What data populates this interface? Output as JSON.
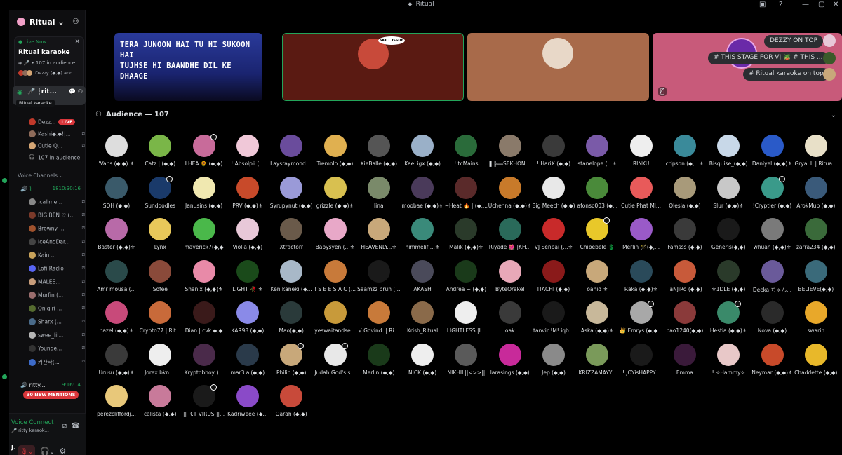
{
  "window": {
    "title": "Ritual"
  },
  "server": {
    "name": "Ritual",
    "chevron": "⌄",
    "invite_icon": "add-member-icon"
  },
  "live_card": {
    "live_now": "Live Now",
    "title": "Ritual karaoke",
    "meta": "• 107 in audience",
    "users": "Dezzy (◆,◆) and ..."
  },
  "active_channel": {
    "name": "┆rit...",
    "tooltip": "Ritual karaoke"
  },
  "stage_users": [
    {
      "name": "Dezz...",
      "live": "LIVE",
      "color": "#c0392b"
    },
    {
      "name": "Kashi◆.◆!|...",
      "color": "#8e6b5a"
    },
    {
      "name": "Cutie Q...",
      "color": "#d4a574"
    },
    {
      "name": "107 in audience",
      "color": ""
    }
  ],
  "voice_channels_label": "Voice Channels",
  "voice_channels": [
    {
      "name": "⌇",
      "time": "1810:30:16",
      "users": [
        {
          "name": ".callme...",
          "color": "#888"
        },
        {
          "name": "BIG BEN ♡ (...",
          "color": "#7b3a2a"
        },
        {
          "name": "Browny ...",
          "color": "#a0522d"
        },
        {
          "name": "IceAndDar...",
          "color": "#444"
        },
        {
          "name": "Kain ...",
          "color": "#c8a25a"
        },
        {
          "name": "Lofi Radio",
          "color": "#5865f2"
        },
        {
          "name": "MALEE...",
          "color": "#c79c7a"
        },
        {
          "name": "Murfin (...",
          "color": "#9a6d6d"
        },
        {
          "name": "Onigiri ...",
          "color": "#556b2f"
        },
        {
          "name": "Sharx (...",
          "color": "#4a6b8a"
        },
        {
          "name": "swee_lil...",
          "color": "#b5b5b5"
        },
        {
          "name": "Younge...",
          "color": "#333"
        },
        {
          "name": "커잔타(...",
          "color": "#3d6bc9"
        }
      ]
    },
    {
      "name": "ritty...",
      "time": "9:16:14"
    }
  ],
  "mentions": "30 NEW MENTIONS",
  "voice_panel": {
    "status": "Voice Connect",
    "sub": "ritty karaok..."
  },
  "user_panel": {
    "name": "J."
  },
  "stage": {
    "lyrics_line1": "TERA JUNOON HAI TU HI SUKOON HAI",
    "lyrics_line2": "TUJHSE HI BAANDHE DIL KE DHAAGE",
    "skill_badge": "SKILL ISSUE",
    "pills": [
      "DEZZY ON TOP",
      "# THIS STAGE FOR VJ 🪴 # THIS ...",
      "# Ritual karaoke on top"
    ]
  },
  "audience": {
    "label": "Audience — 107"
  },
  "audience_rows": [
    [
      {
        "n": "'Vans (◆,◆) ⚜",
        "c": "#ddd"
      },
      {
        "n": "Catz | (◆,◆)",
        "c": "#7ab648"
      },
      {
        "n": "LHEA 🌻 (◆,◆)",
        "c": "#c86b9a",
        "d": true
      },
      {
        "n": "! Absolpii (...",
        "c": "#f0c8d8"
      },
      {
        "n": "Laysraymond ...",
        "c": "#6a4c9c"
      },
      {
        "n": "Tremolo (◆,◆)",
        "c": "#e0b050"
      },
      {
        "n": "XieBalle (◆,◆)",
        "c": "#555"
      },
      {
        "n": "KaeLigx (◆,◆)",
        "c": "#9ab0c8"
      },
      {
        "n": "! tcMains",
        "c": "#2a6b3a"
      },
      {
        "n": "▌╠══SEKHON...",
        "c": "#8a7a6a"
      },
      {
        "n": "! HariX (◆,◆)",
        "c": "#3a3a3a"
      },
      {
        "n": "stanelope (...⚜",
        "c": "#7a5aa8"
      },
      {
        "n": "RINKU",
        "c": "#eee"
      },
      {
        "n": "cripson (◆,...⚜",
        "c": "#3a8a9a"
      },
      {
        "n": "Bisquise_(◆,◆)",
        "c": "#c8d8e8"
      },
      {
        "n": "Daniyel (◆,◆)⚜",
        "c": "#2a5ac8"
      },
      {
        "n": "Gryal L | Ritua...",
        "c": "#e8e0c8"
      }
    ],
    [
      {
        "n": "SOH (◆,◆)",
        "c": "#3a5a6a"
      },
      {
        "n": "Sundoodles",
        "c": "#1a3a6a",
        "d": true
      },
      {
        "n": "Janusins (◆,◆)",
        "c": "#f0e8b0"
      },
      {
        "n": "PRV (◆,◆)⚜",
        "c": "#c84a2a"
      },
      {
        "n": "Syrupynut (◆,◆)",
        "c": "#9a9ad8"
      },
      {
        "n": "grizzle (◆,◆)⚜",
        "c": "#d8c050"
      },
      {
        "n": "lina",
        "c": "#7a8a6a"
      },
      {
        "n": "moobae (◆,◆)⚜",
        "c": "#4a3a5a"
      },
      {
        "n": "~Heat 🔥 | (◆,...",
        "c": "#5a2a2a"
      },
      {
        "n": "Uchenna (◆,◆)⚜",
        "c": "#c87a2a"
      },
      {
        "n": "Big Meech (◆,◆)",
        "c": "#e8e8e8"
      },
      {
        "n": "afonso003 (◆...",
        "c": "#4a8a3a"
      },
      {
        "n": "Cutie Phat Ml...",
        "c": "#e85a5a"
      },
      {
        "n": "Olesia (◆,◆)",
        "c": "#a89a7a"
      },
      {
        "n": "Slur (◆,◆)⚜",
        "c": "#c8c8c8"
      },
      {
        "n": "!Cryptier (◆,◆)",
        "c": "#3a9a8a",
        "d": true
      },
      {
        "n": "ArokMub (◆,◆)",
        "c": "#3a5a7a"
      }
    ],
    [
      {
        "n": "Baster (◆,◆)⚜",
        "c": "#b86aa8"
      },
      {
        "n": "Lynx",
        "c": "#e8c85a"
      },
      {
        "n": "maverick7(◆,◆",
        "c": "#4ab84a"
      },
      {
        "n": "Violla (◆,◆)",
        "c": "#e8c8d8"
      },
      {
        "n": "Xtractorr",
        "c": "#6a5a4a"
      },
      {
        "n": "Babysyen (...⚜",
        "c": "#e8a8c8"
      },
      {
        "n": "HEAVENLY...⚜",
        "c": "#c8a87a"
      },
      {
        "n": "himmelif ...⚜",
        "c": "#3a8a7a"
      },
      {
        "n": "Malik (◆,◆)⚜",
        "c": "#2a3a2a"
      },
      {
        "n": "Riyade 🌺 |KH...",
        "c": "#2a6a5a"
      },
      {
        "n": "VJ Senpai (...⚜",
        "c": "#c82a2a"
      },
      {
        "n": "Chibebele 💲",
        "c": "#e8c82a",
        "d": true
      },
      {
        "n": "Merlin 🪄(◆,...",
        "c": "#9a5ac8"
      },
      {
        "n": "Famsss (◆,◆)",
        "c": "#3a3a3a"
      },
      {
        "n": "Generis(◆,◆)",
        "c": "#1a1a1a"
      },
      {
        "n": "whuan (◆,◆)⚜",
        "c": "#7a7a7a"
      },
      {
        "n": "zarra234 (◆,◆)",
        "c": "#3a6a3a"
      }
    ],
    [
      {
        "n": "Amr mousa (...",
        "c": "#2a4a4a"
      },
      {
        "n": "Sofee",
        "c": "#8a4a3a"
      },
      {
        "n": "Shanix (◆,◆)⚜",
        "c": "#e88aa8"
      },
      {
        "n": "LIGHT 🥀 ⚜",
        "c": "#1a4a1a"
      },
      {
        "n": "Ken kaneki (◆...",
        "c": "#a8b8c8"
      },
      {
        "n": "! S E E S A C (...",
        "c": "#c87a3a"
      },
      {
        "n": "Saamzz bruh (...",
        "c": "#1a1a1a"
      },
      {
        "n": "AKASH",
        "c": "#4a4a5a"
      },
      {
        "n": "Andrea ~ (◆,◆)",
        "c": "#1a3a1a"
      },
      {
        "n": "ByteOrakel",
        "c": "#e8a8b8"
      },
      {
        "n": "ITACHI (◆,◆)",
        "c": "#8a1a1a"
      },
      {
        "n": "oahid ⚜",
        "c": "#c8a87a"
      },
      {
        "n": "Raka (◆,◆)⚜",
        "c": "#2a4a5a"
      },
      {
        "n": "TaNJiRo (◆,◆)",
        "c": "#c85a3a"
      },
      {
        "n": "⚜1DLE (◆,◆)",
        "c": "#2a3a2a"
      },
      {
        "n": "Decka ちゃん...",
        "c": "#6a5a9a"
      },
      {
        "n": "BELIEVE(◆,◆)",
        "c": "#3a6a7a"
      }
    ],
    [
      {
        "n": "hazel (◆,◆)⚜",
        "c": "#c84a7a"
      },
      {
        "n": "Crypto77 | Rit...",
        "c": "#c86a3a"
      },
      {
        "n": "Dian | cvk ◆,◆",
        "c": "#3a1a1a"
      },
      {
        "n": "KAR98 (◆,◆)",
        "c": "#8a8ae8"
      },
      {
        "n": "Mao(◆,◆)",
        "c": "#2a3a3a"
      },
      {
        "n": "yeswaitandse...",
        "c": "#c89a3a"
      },
      {
        "n": "√ Govind..| Ri...",
        "c": "#c87a3a"
      },
      {
        "n": "Krish_Ritual",
        "c": "#8a6a4a"
      },
      {
        "n": "LIGHTLESS |I...",
        "c": "#eee"
      },
      {
        "n": "oak",
        "c": "#3a3a3a"
      },
      {
        "n": "tanvir !M! iqb...",
        "c": "#1a1a1a"
      },
      {
        "n": "Aska (◆,◆)⚜",
        "c": "#c8b89a"
      },
      {
        "n": "👑 Emrys (◆,◆...",
        "c": "#a8a8a8",
        "d": true
      },
      {
        "n": "bao1240(◆,◆)",
        "c": "#8a3a3a"
      },
      {
        "n": "Hestia (◆,◆)⚜",
        "c": "#3a8a6a",
        "d": true
      },
      {
        "n": "Nova (◆,◆)",
        "c": "#2a2a2a"
      },
      {
        "n": "swarih",
        "c": "#e8a82a"
      }
    ],
    [
      {
        "n": "Urusu (◆,◆)⚜",
        "c": "#3a3a3a"
      },
      {
        "n": "Jorex bkn ...",
        "c": "#eee"
      },
      {
        "n": "Kryptobhoy (...",
        "c": "#4a2a4a"
      },
      {
        "n": "mar3.ai(◆,◆)",
        "c": "#2a3a4a"
      },
      {
        "n": "Philip (◆,◆)",
        "c": "#c8a87a",
        "d": true
      },
      {
        "n": "Judah God's s...",
        "c": "#e8e8e8",
        "d": true
      },
      {
        "n": "Merlin (◆,◆)",
        "c": "#1a3a1a"
      },
      {
        "n": "NICK (◆,◆)",
        "c": "#eee"
      },
      {
        "n": "NIKHIL||<>>||",
        "c": "#5a5a5a"
      },
      {
        "n": "larasings (◆,◆)",
        "c": "#c82a9a"
      },
      {
        "n": "Jep (◆,◆)",
        "c": "#8a8a8a"
      },
      {
        "n": "KRIZZAMAYY...",
        "c": "#7a9a5a"
      },
      {
        "n": "! JOYisHAPPY...",
        "c": "#1a1a1a"
      },
      {
        "n": "Emma",
        "c": "#3a1a3a"
      },
      {
        "n": "! ✧Hammy✧",
        "c": "#e8c8c8"
      },
      {
        "n": "Neymar (◆,◆)⚜",
        "c": "#c84a2a"
      },
      {
        "n": "Chaddette (◆,◆)",
        "c": "#e8b82a"
      }
    ],
    [
      {
        "n": "perezcliffordj...",
        "c": "#e8c87a"
      },
      {
        "n": "calista (◆,◆)",
        "c": "#c87a9a"
      },
      {
        "n": "|| R.T VIRUS ||...",
        "c": "#1a1a1a",
        "d": true
      },
      {
        "n": "Kadriweee (◆...",
        "c": "#8a4ac8"
      },
      {
        "n": "Qarah (◆,◆)",
        "c": "#c84a3a"
      }
    ]
  ]
}
